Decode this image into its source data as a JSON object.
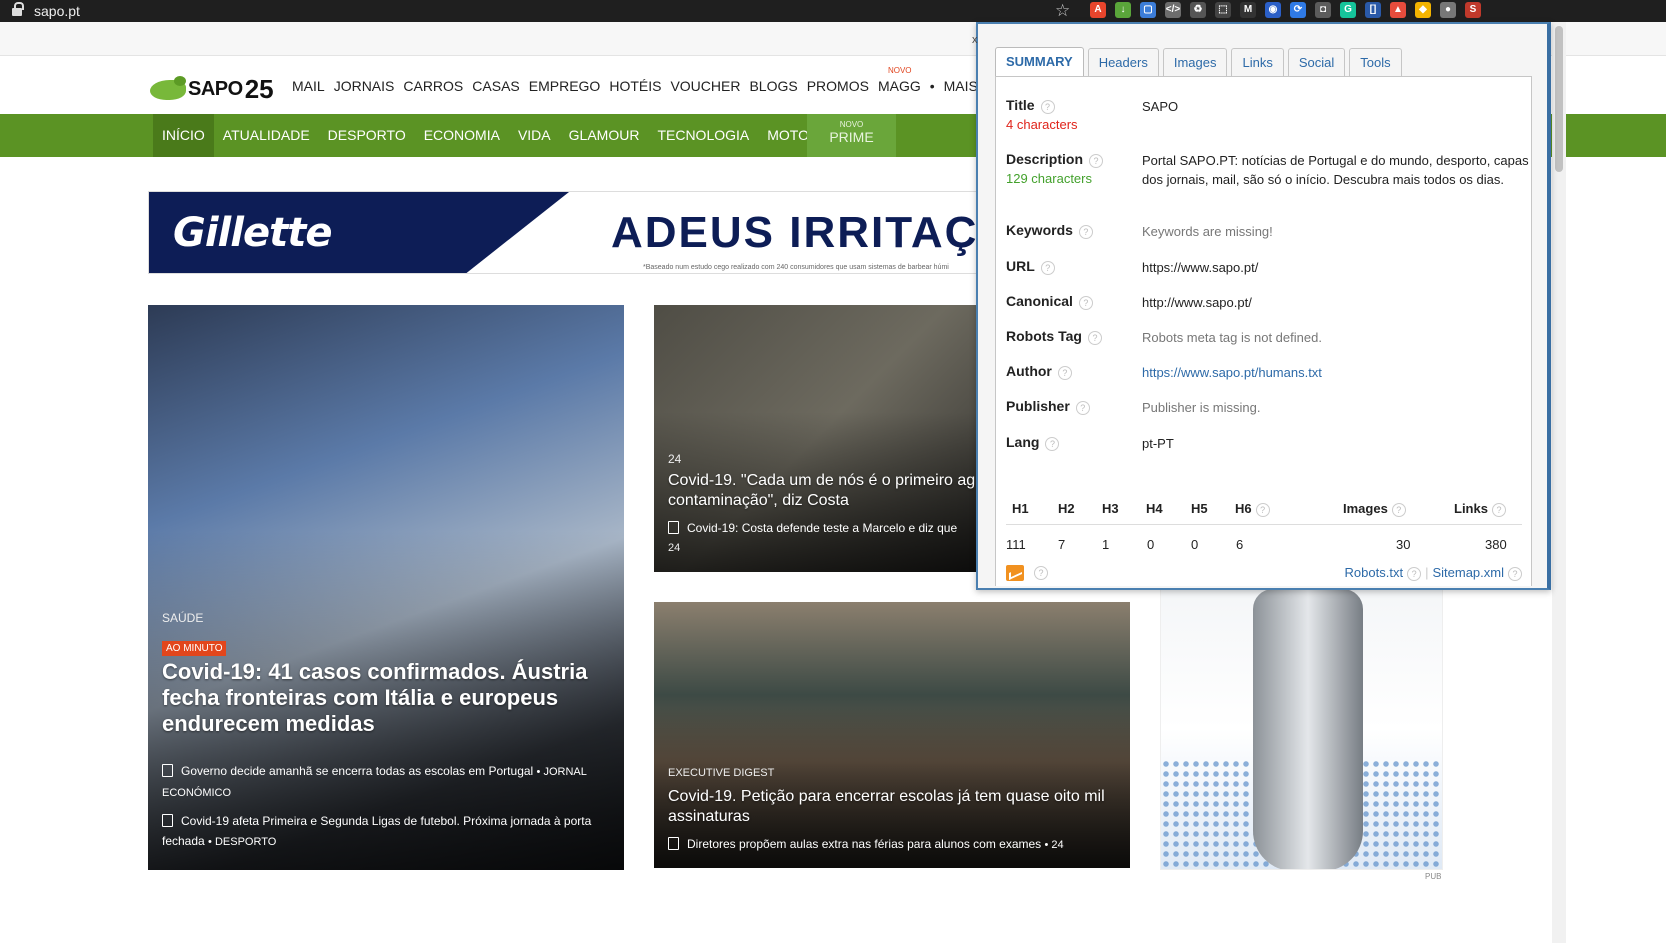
{
  "browser": {
    "url": "sapo.pt",
    "extension_icons": [
      {
        "name": "acrobat-icon",
        "color": "#e8452c",
        "glyph": "A"
      },
      {
        "name": "download-icon",
        "color": "#5aa53a",
        "glyph": "↓"
      },
      {
        "name": "window-icon",
        "color": "#3c7dd8",
        "glyph": "▢"
      },
      {
        "name": "code-icon",
        "color": "#6d6d6d",
        "glyph": "</>"
      },
      {
        "name": "recycle-icon",
        "color": "#555555",
        "glyph": "♻"
      },
      {
        "name": "screenshot-icon",
        "color": "#444444",
        "glyph": "⬚"
      },
      {
        "name": "m-icon",
        "color": "#333333",
        "glyph": "M"
      },
      {
        "name": "owl-icon",
        "color": "#2b5fc7",
        "glyph": "◉"
      },
      {
        "name": "sync-icon",
        "color": "#2f7ae5",
        "glyph": "⟳"
      },
      {
        "name": "camera-icon",
        "color": "#5c5c5c",
        "glyph": "◘"
      },
      {
        "name": "grammarly-icon",
        "color": "#15c39a",
        "glyph": "G"
      },
      {
        "name": "bracket-icon",
        "color": "#2a59a8",
        "glyph": "[]"
      },
      {
        "name": "rocket-icon",
        "color": "#e74c3c",
        "glyph": "▲"
      },
      {
        "name": "drive-icon",
        "color": "#f4b400",
        "glyph": "◆"
      },
      {
        "name": "record-icon",
        "color": "#777777",
        "glyph": "●"
      },
      {
        "name": "profile-icon",
        "color": "#c0392b",
        "glyph": "S"
      }
    ]
  },
  "site": {
    "logo_word": "SAPO",
    "logo_number": "25",
    "top_menu": [
      "MAIL",
      "JORNAIS",
      "CARROS",
      "CASAS",
      "EMPREGO",
      "HOTÉIS",
      "VOUCHER",
      "BLOGS",
      "PROMOS",
      "MAGG",
      "•",
      "MAIS ⌄"
    ],
    "novo_label": "NOVO",
    "green_nav": [
      "INÍCIO",
      "ATUALIDADE",
      "DESPORTO",
      "ECONOMIA",
      "VIDA",
      "GLAMOUR",
      "TECNOLOGIA",
      "MOTORES"
    ],
    "prime_novo": "NOVO",
    "prime_label": "PRIME"
  },
  "banner": {
    "brand": "Gillette",
    "headline": "ADEUS IRRITAÇÃ",
    "fine_print": "*Baseado num estudo cego realizado com 240 consumidores que usam sistemas de barbear húmi"
  },
  "cards": {
    "main": {
      "section": "SAÚDE",
      "badge": "AO MINUTO",
      "headline": "Covid-19: 41 casos confirmados. Áustria fecha fronteiras com Itália e europeus endurecem medidas",
      "related": [
        {
          "text": "Governo decide amanhã se encerra todas as escolas em Portugal",
          "source": "• JORNAL ECONÓMICO"
        },
        {
          "text": "Covid-19 afeta Primeira e Segunda Ligas de futebol. Próxima jornada à porta fechada",
          "source": "• DESPORTO"
        }
      ]
    },
    "second": {
      "section": "24",
      "headline": "Covid-19. \"Cada um de nós é o primeiro ag contaminação\", diz Costa",
      "related": "Covid-19: Costa defende teste a Marcelo e diz que",
      "source": "24"
    },
    "third": {
      "section": "EXECUTIVE DIGEST",
      "headline": "Covid-19. Petição para encerrar escolas já tem quase oito mil assinaturas",
      "related": "Diretores propõem aulas extra nas férias para alunos com exames",
      "source": "• 24"
    }
  },
  "ad_label": "PUB",
  "seo_panel": {
    "tabs": [
      "SUMMARY",
      "Headers",
      "Images",
      "Links",
      "Social",
      "Tools"
    ],
    "active_tab": "SUMMARY",
    "help_glyph": "?",
    "fields": {
      "title": {
        "label": "Title",
        "meta": "4 characters",
        "value": "SAPO"
      },
      "description": {
        "label": "Description",
        "meta": "129 characters",
        "value": "Portal SAPO.PT: notícias de Portugal e do mundo, desporto, capas dos jornais, mail, são só o início. Descubra mais todos os dias."
      },
      "keywords": {
        "label": "Keywords",
        "value": "Keywords are missing!"
      },
      "url": {
        "label": "URL",
        "value": "https://www.sapo.pt/"
      },
      "canonical": {
        "label": "Canonical",
        "value": "http://www.sapo.pt/"
      },
      "robots": {
        "label": "Robots Tag",
        "value": "Robots meta tag is not defined."
      },
      "author": {
        "label": "Author",
        "value": "https://www.sapo.pt/humans.txt"
      },
      "publisher": {
        "label": "Publisher",
        "value": "Publisher is missing."
      },
      "lang": {
        "label": "Lang",
        "value": "pt-PT"
      }
    },
    "headings": {
      "columns": [
        "H1",
        "H2",
        "H3",
        "H4",
        "H5",
        "H6",
        "Images",
        "Links"
      ],
      "values": [
        "111",
        "7",
        "1",
        "0",
        "0",
        "6",
        "30",
        "380"
      ]
    },
    "footer": {
      "robots_link": "Robots.txt",
      "sitemap_link": "Sitemap.xml",
      "separator": "|"
    },
    "close_glyph": "x",
    "colors": {
      "accent": "#2d6aa8",
      "warning": "#e0241b",
      "ok": "#43a12c"
    }
  }
}
